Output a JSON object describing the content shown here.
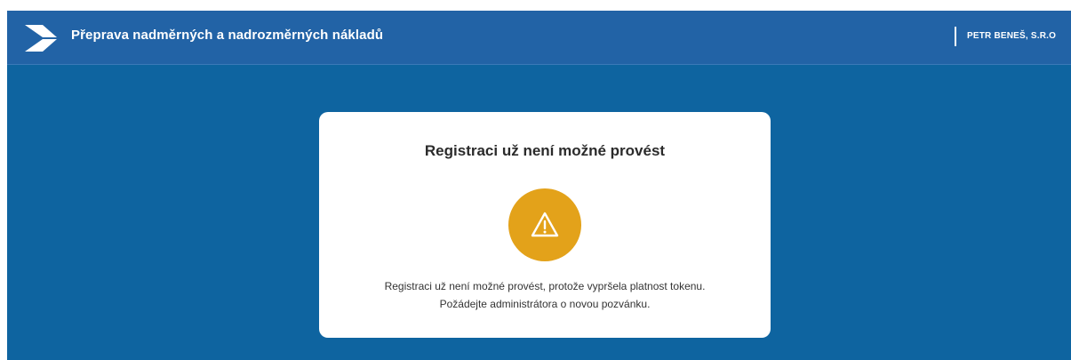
{
  "header": {
    "logo_icon": "arrow-logo-icon",
    "title": "Přeprava nadměrných a nadrozměrných nákladů",
    "company": "PETR BENEŠ, S.R.O"
  },
  "dialog": {
    "title": "Registraci už není možné provést",
    "icon": "warning-icon",
    "message_line1": "Registraci už není možné provést, protože vypršela platnost tokenu.",
    "message_line2": "Požádejte administrátora o novou pozvánku."
  },
  "colors": {
    "header_bg": "#2263a6",
    "page_bg": "#0e64a0",
    "card_bg": "#ffffff",
    "warning": "#e3a21a"
  }
}
